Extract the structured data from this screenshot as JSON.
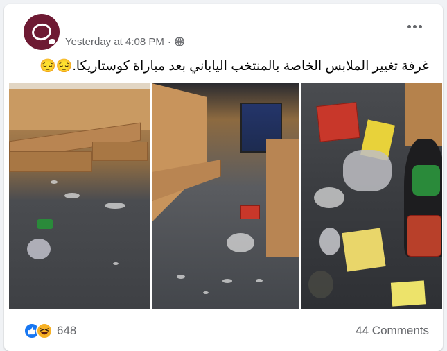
{
  "post": {
    "timestamp": "Yesterday at 4:08 PM",
    "separator": "·",
    "privacy_icon": "globe-icon",
    "text": "غرفة تغيير الملابس الخاصة بالمنتخب الياباني بعد مباراة كوستاريكا.😔😔",
    "more_icon": "more-options-icon"
  },
  "photos": [
    {
      "name": "locker-room-photo-1"
    },
    {
      "name": "locker-room-photo-2"
    },
    {
      "name": "locker-room-photo-3"
    }
  ],
  "footer": {
    "reaction_icons": [
      "like-icon",
      "haha-icon"
    ],
    "reaction_count": "648",
    "comments_label": "44 Comments"
  },
  "colors": {
    "avatar_bg": "#6e1a33",
    "like_blue": "#1877f2",
    "haha_yellow": "#f7b125",
    "meta_gray": "#65676b"
  }
}
